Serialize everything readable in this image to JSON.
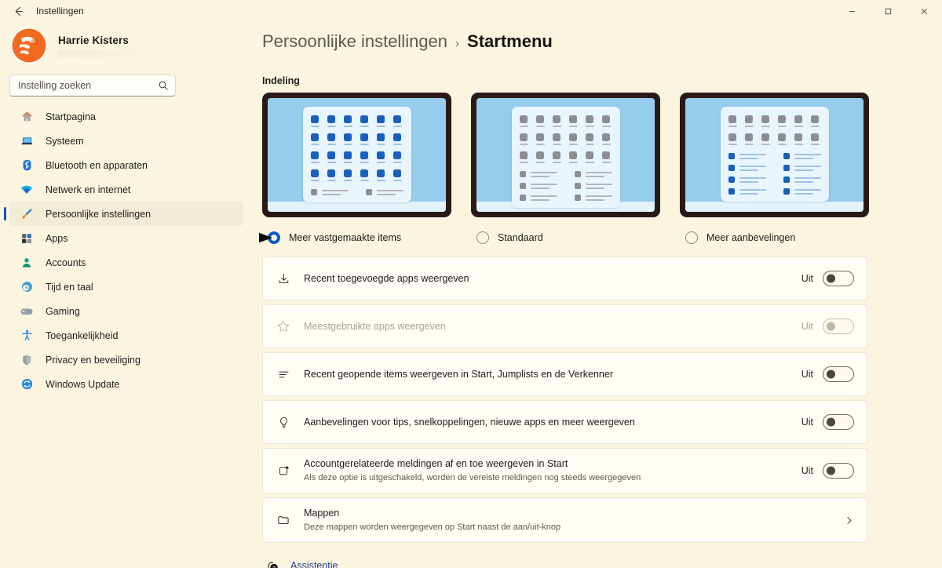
{
  "window": {
    "title": "Instellingen",
    "back_icon": "back-arrow-icon",
    "minimize_label": "─",
    "maximize_label": "□",
    "close_label": "✕"
  },
  "profile": {
    "name": "Harrie Kisters",
    "email_redacted": ""
  },
  "search": {
    "placeholder": "Instelling zoeken",
    "value": "",
    "icon": "search-icon"
  },
  "sidebar": {
    "items": [
      {
        "label": "Startpagina",
        "icon": "home-icon",
        "active": false
      },
      {
        "label": "Systeem",
        "icon": "laptop-icon",
        "active": false
      },
      {
        "label": "Bluetooth en apparaten",
        "icon": "bluetooth-icon",
        "active": false
      },
      {
        "label": "Netwerk en internet",
        "icon": "wifi-icon",
        "active": false
      },
      {
        "label": "Persoonlijke instellingen",
        "icon": "paintbrush-icon",
        "active": true
      },
      {
        "label": "Apps",
        "icon": "apps-icon",
        "active": false
      },
      {
        "label": "Accounts",
        "icon": "person-icon",
        "active": false
      },
      {
        "label": "Tijd en taal",
        "icon": "clock-icon",
        "active": false
      },
      {
        "label": "Gaming",
        "icon": "gamepad-icon",
        "active": false
      },
      {
        "label": "Toegankelijkheid",
        "icon": "accessibility-icon",
        "active": false
      },
      {
        "label": "Privacy en beveiliging",
        "icon": "shield-icon",
        "active": false
      },
      {
        "label": "Windows Update",
        "icon": "update-icon",
        "active": false
      }
    ]
  },
  "breadcrumb": {
    "parent": "Persoonlijke instellingen",
    "separator": "›",
    "current": "Startmenu"
  },
  "layout_section": {
    "title": "Indeling",
    "options": [
      {
        "label": "Meer vastgemaakte items",
        "selected": true,
        "pin_rows": 4,
        "pin_cols": 6,
        "pin_color": "blue",
        "rec_rows": 1,
        "rec_color": "grey"
      },
      {
        "label": "Standaard",
        "selected": false,
        "pin_rows": 3,
        "pin_cols": 6,
        "pin_color": "grey",
        "rec_rows": 3,
        "rec_color": "grey"
      },
      {
        "label": "Meer aanbevelingen",
        "selected": false,
        "pin_rows": 2,
        "pin_cols": 6,
        "pin_color": "grey",
        "rec_rows": 4,
        "rec_color": "blue"
      }
    ],
    "annotation": "arrow pointing to selected option"
  },
  "settings_rows": [
    {
      "icon": "download-icon",
      "title": "Recent toegevoegde apps weergeven",
      "subtitle": "",
      "control": "toggle",
      "state_label": "Uit",
      "on": false,
      "disabled": false
    },
    {
      "icon": "star-icon",
      "title": "Meestgebruikte apps weergeven",
      "subtitle": "",
      "control": "toggle",
      "state_label": "Uit",
      "on": false,
      "disabled": true
    },
    {
      "icon": "list-icon",
      "title": "Recent geopende items weergeven in Start, Jumplists en de Verkenner",
      "subtitle": "",
      "control": "toggle",
      "state_label": "Uit",
      "on": false,
      "disabled": false
    },
    {
      "icon": "lightbulb-icon",
      "title": "Aanbevelingen voor tips, snelkoppelingen, nieuwe apps en meer weergeven",
      "subtitle": "",
      "control": "toggle",
      "state_label": "Uit",
      "on": false,
      "disabled": false
    },
    {
      "icon": "notification-badge-icon",
      "title": "Accountgerelateerde meldingen af en toe weergeven in Start",
      "subtitle": "Als deze optie is uitgeschakeld, worden de vereiste meldingen nog steeds weergegeven",
      "control": "toggle",
      "state_label": "Uit",
      "on": false,
      "disabled": false
    },
    {
      "icon": "folder-icon",
      "title": "Mappen",
      "subtitle": "Deze mappen worden weergegeven op Start naast de aan/uit-knop",
      "control": "chevron",
      "state_label": "",
      "on": false,
      "disabled": false
    }
  ],
  "footer": {
    "icon": "help-question-icon",
    "link": "Assistentie"
  },
  "colors": {
    "background": "#fbf5e0",
    "card": "#fffdf6",
    "accent_blue": "#0b5bc4",
    "link_blue": "#1f3c8c",
    "preview_bezel": "#2a1a17",
    "preview_wallpaper": "#96cdee"
  }
}
